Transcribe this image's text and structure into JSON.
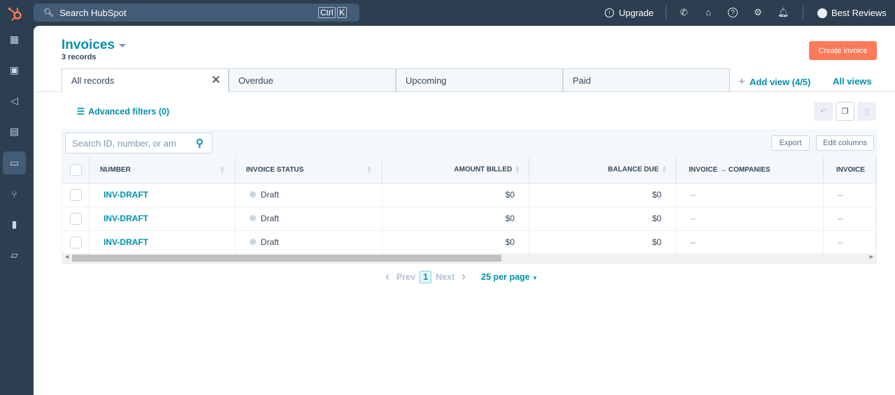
{
  "topbar": {
    "search_placeholder": "Search HubSpot",
    "kbd_ctrl": "Ctrl",
    "kbd_k": "K",
    "upgrade": "Upgrade",
    "account": "Best Reviews",
    "icons": [
      "phone-icon",
      "marketplace-icon",
      "help-icon",
      "settings-icon",
      "notifications-icon"
    ]
  },
  "sidebar": {
    "items": [
      "dashboard",
      "contacts",
      "marketing",
      "content",
      "commerce",
      "automation",
      "reporting",
      "library"
    ],
    "active": "commerce"
  },
  "header": {
    "title": "Invoices",
    "count": "3 records",
    "create_label": "Create invoice"
  },
  "tabs": [
    {
      "label": "All records"
    },
    {
      "label": "Overdue"
    },
    {
      "label": "Upcoming"
    },
    {
      "label": "Paid"
    }
  ],
  "add_view": "Add view (4/5)",
  "all_views": "All views",
  "advanced_filters": "Advanced filters (0)",
  "table": {
    "search_placeholder": "Search ID, number, or am",
    "export": "Export",
    "edit_columns": "Edit columns",
    "columns": [
      "NUMBER",
      "INVOICE STATUS",
      "AMOUNT BILLED",
      "BALANCE DUE",
      "INVOICE → COMPANIES",
      "INVOICE"
    ],
    "rows": [
      {
        "number": "INV-DRAFT",
        "status": "Draft",
        "amount": "$0",
        "balance": "$0",
        "companies": "--",
        "invoice": "--"
      },
      {
        "number": "INV-DRAFT",
        "status": "Draft",
        "amount": "$0",
        "balance": "$0",
        "companies": "--",
        "invoice": "--"
      },
      {
        "number": "INV-DRAFT",
        "status": "Draft",
        "amount": "$0",
        "balance": "$0",
        "companies": "--",
        "invoice": "--"
      }
    ]
  },
  "pagination": {
    "prev": "Prev",
    "page": "1",
    "next": "Next",
    "per_page": "25 per page"
  },
  "colors": {
    "accent": "#0091ae",
    "primary_button": "#ff7a59",
    "nav": "#2d3e50"
  }
}
